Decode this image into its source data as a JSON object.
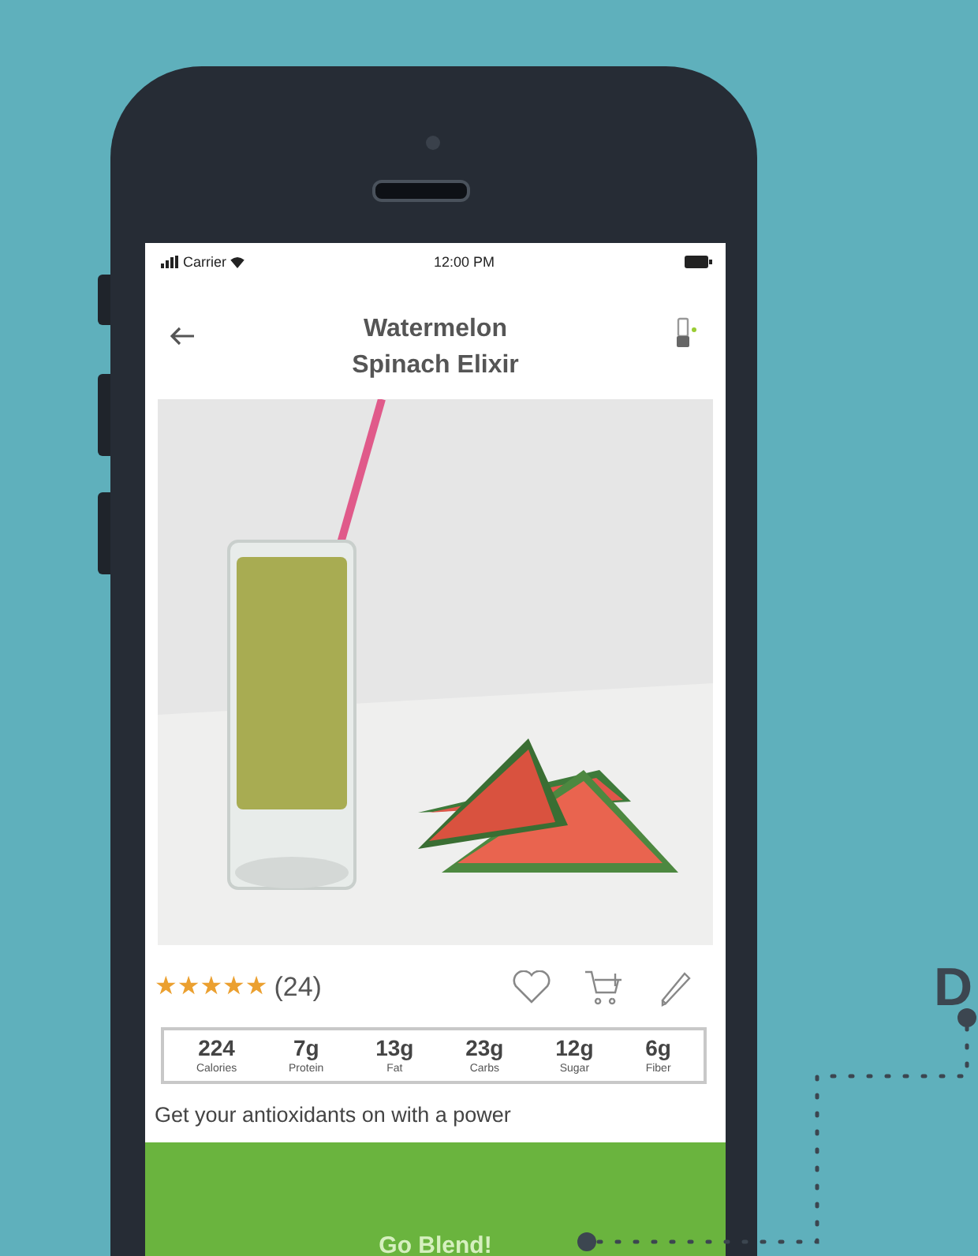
{
  "status_bar": {
    "carrier": "Carrier",
    "time": "12:00 PM"
  },
  "header": {
    "title": "Watermelon Spinach Elixir"
  },
  "recipe": {
    "stars": 5,
    "rating_count": "(24)"
  },
  "nutrition": [
    {
      "value": "224",
      "label": "Calories"
    },
    {
      "value": "7g",
      "label": "Protein"
    },
    {
      "value": "13g",
      "label": "Fat"
    },
    {
      "value": "23g",
      "label": "Carbs"
    },
    {
      "value": "12g",
      "label": "Sugar"
    },
    {
      "value": "6g",
      "label": "Fiber"
    }
  ],
  "description": "Get your antioxidants on with a power",
  "action_button": "Go Blend!",
  "callout": {
    "letter": "D"
  }
}
